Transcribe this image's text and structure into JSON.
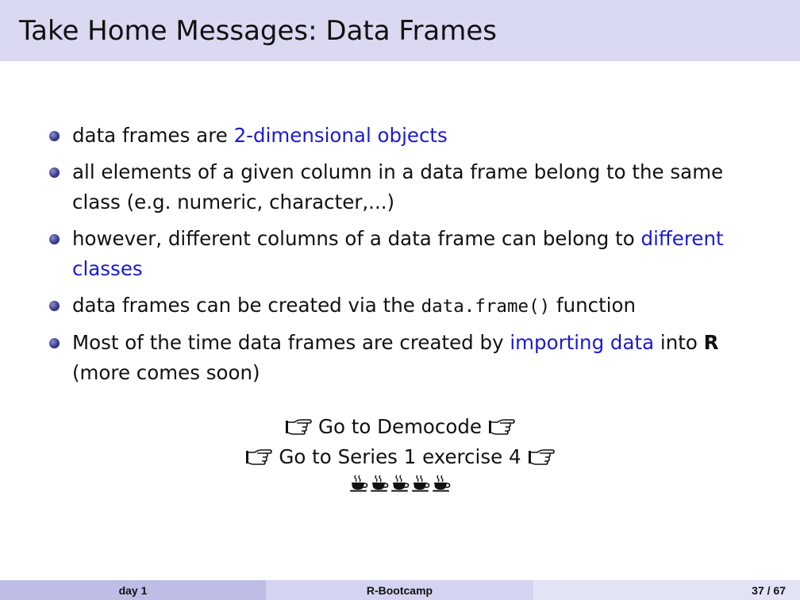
{
  "slide": {
    "title": "Take Home Messages: Data Frames",
    "bullets": [
      {
        "text_before": "data frames are ",
        "highlight": "2-dimensional objects"
      },
      {
        "text": "all elements of a given column in a data frame belong to the same class (e.g. numeric, character,...)"
      },
      {
        "text_before": "however, different columns of a data frame can belong to ",
        "highlight": "different classes"
      },
      {
        "text_before": "data frames can be created via the ",
        "code": "data.frame()",
        "text_after": " function"
      },
      {
        "text_before": "Most of the time data frames are created by ",
        "highlight": "importing data",
        "text_middle": " into ",
        "bold": "R",
        "text_after": " (more comes soon)"
      }
    ],
    "links": {
      "democode": "Go to Democode",
      "exercise": "Go to Series 1 exercise 4"
    },
    "hand_icon": "pointing-hand-icon",
    "cup_icon": "coffee-cup-icon",
    "coffee_cups": 5,
    "highlight_color": "#1a1ad6"
  },
  "footer": {
    "left": "day 1",
    "center": "R-Bootcamp",
    "right": "37 / 67"
  }
}
